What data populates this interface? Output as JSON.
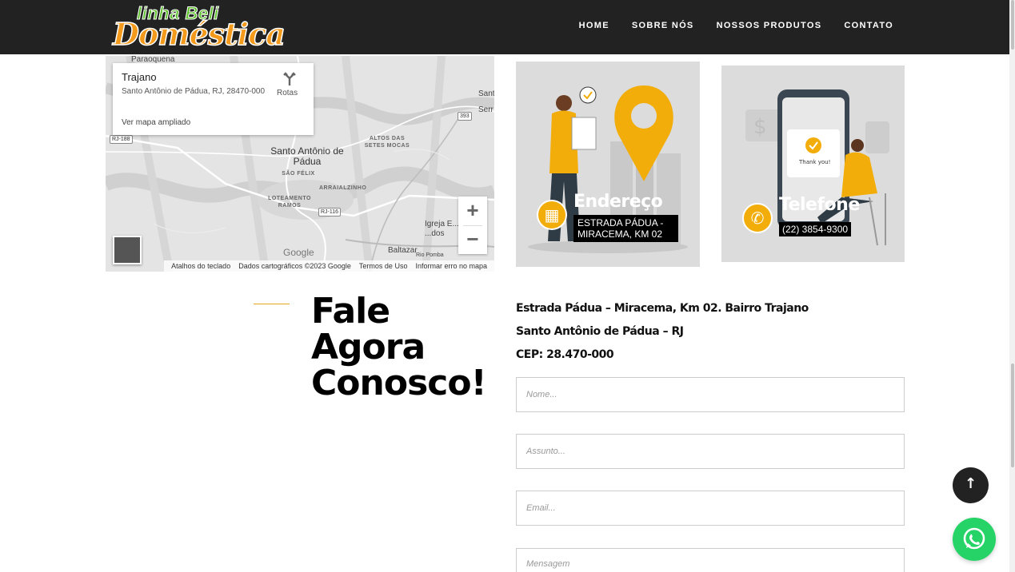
{
  "header": {
    "logo_line1": "linha Beli",
    "logo_line2": "Doméstica",
    "nav": [
      "HOME",
      "SOBRE NÓS",
      "NOSSOS PRODUTOS",
      "CONTATO"
    ]
  },
  "map": {
    "place_title": "Trajano",
    "place_address": "Santo Antônio de Pádua, RJ, 28470-000",
    "view_larger": "Ver mapa ampliado",
    "directions": "Rotas",
    "labels": {
      "paraoquena": "Paraoquena",
      "sant": "Sant",
      "serr": "Serr",
      "city": "Santo Antônio de Pádua",
      "sao_felix": "SÃO FÉLIX",
      "altos": "ALTOS DAS SETES MOCAS",
      "arraial": "ARRAIALZINHO",
      "loteamento": "LOTEAMENTO RAMOS",
      "igreja": "Igreja E... ...dos",
      "baltazar": "Baltazar",
      "rio_pomba": "Rio Pomba",
      "rj188": "RJ-188",
      "r393": "393",
      "rj116": "RJ-116"
    },
    "zoom_in": "+",
    "zoom_out": "−",
    "google": "Google",
    "footer": [
      "Atalhos do teclado",
      "Dados cartográficos ©2023 Google",
      "Termos de Uso",
      "Informar erro no mapa"
    ]
  },
  "cards": {
    "address": {
      "title": "Endereço",
      "text": "ESTRADA PÁDUA - MIRACEMA, KM 02"
    },
    "phone": {
      "title": "Telefone",
      "text": "(22) 3854-9300"
    }
  },
  "contact": {
    "heading_lines": [
      "Fale",
      "Agora",
      "Conosco!"
    ],
    "address_lines": [
      "Estrada Pádua – Miracema, Km 02. Bairro Trajano",
      "Santo Antônio de Pádua – RJ",
      "CEP: 28.470-000"
    ],
    "form": {
      "name_placeholder": "Nome...",
      "subject_placeholder": "Assunto...",
      "email_placeholder": "Email...",
      "message_placeholder": "Mensagem"
    }
  },
  "colors": {
    "accent": "#f3ad0a",
    "header_bg": "#222222",
    "whatsapp": "#25d366"
  }
}
